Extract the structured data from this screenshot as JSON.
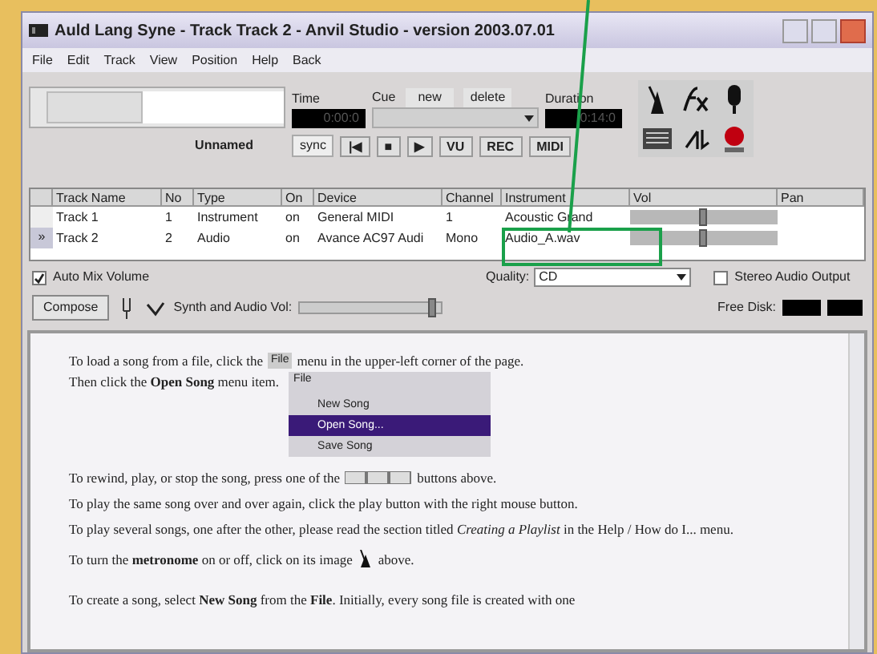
{
  "window": {
    "title": "Auld Lang Syne - Track Track 2 - Anvil Studio - version 2003.07.01"
  },
  "menu": [
    "File",
    "Edit",
    "Track",
    "View",
    "Position",
    "Help",
    "Back"
  ],
  "toolbar": {
    "time_label": "Time",
    "time": "0:00:0",
    "cue_label": "Cue",
    "cue_new": "new",
    "cue_delete": "delete",
    "duration_label": "Duration",
    "duration": "0:14:0",
    "song_name": "Unnamed",
    "sync": "sync",
    "transport": [
      {
        "label": "|◀",
        "selected": false
      },
      {
        "label": "■",
        "selected": false
      },
      {
        "label": "▶",
        "selected": false
      },
      {
        "label": "VU",
        "selected": false
      },
      {
        "label": "REC",
        "selected": false
      },
      {
        "label": "MIDI",
        "selected": false
      }
    ]
  },
  "tracks": {
    "columns": [
      "Track Name",
      "No",
      "Type",
      "On",
      "Device",
      "Channel",
      "Instrument",
      "Vol",
      "Pan"
    ],
    "rows": [
      {
        "marker": "",
        "cells": [
          "Track 1",
          "1",
          "Instrument",
          "on",
          "General MIDI",
          "1",
          "Acoustic Grand"
        ],
        "level": 0.5,
        "selected": false
      },
      {
        "marker": "»",
        "cells": [
          "Track 2",
          "2",
          "Audio",
          "on",
          "Avance AC97 Audi",
          "Mono",
          "Audio_A.wav"
        ],
        "level": 0.5,
        "selected": true
      }
    ]
  },
  "options": {
    "auto_mix": {
      "label": "Auto Mix Volume",
      "checked": true
    },
    "quality_label": "Quality:",
    "quality": "CD",
    "stereo": {
      "label": "Stereo Audio Output",
      "checked": false
    },
    "compose": "Compose",
    "synth_vol": {
      "label": "Synth and Audio Vol:",
      "level": 0.95
    },
    "free_disk_label": "Free Disk:"
  },
  "help": {
    "intro_before": "To load a song from a file, click the",
    "file_button": "File",
    "intro_after": "menu in the upper-left corner of the page.",
    "open_song": "Then click the **Open Song** menu item.",
    "menu_title": "File",
    "menu_items": [
      {
        "label": "New Song",
        "selected": false
      },
      {
        "label": "Open Song...",
        "selected": true
      },
      {
        "label": "Save Song",
        "selected": false
      }
    ],
    "rewind_before": "To rewind, play, or stop the song, press one of the",
    "rewind_after": "buttons above.",
    "paragraphs": [
      "To play the same song over and over again, click the play button with the right mouse button.",
      "To play several songs, one after the other, please read the section titled *Creating a Playlist* in the Help / How do I... menu."
    ],
    "metronome_before": "To turn the **metronome** on or off, click on its image",
    "metronome_after": "above.",
    "create": "To create a song, select **New Song** from the **File**. Initially, every song file is created with one"
  }
}
